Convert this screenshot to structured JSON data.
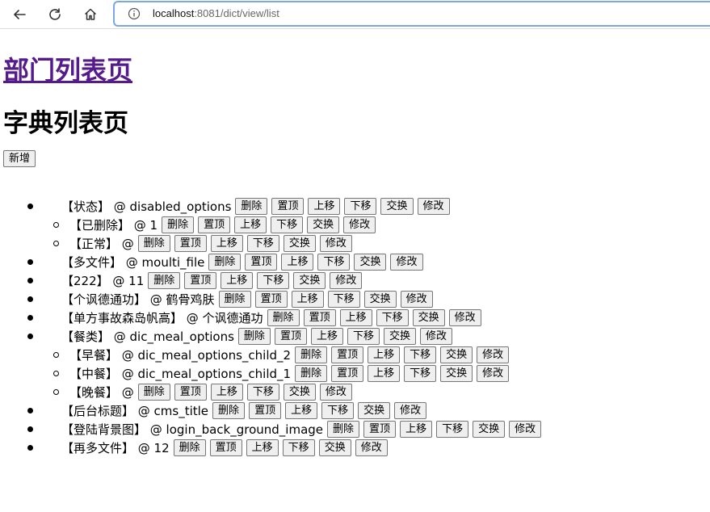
{
  "browser": {
    "url_host": "localhost",
    "url_path": ":8081/dict/view/list"
  },
  "page": {
    "dept_link": "部门列表页",
    "title": "字典列表页",
    "add_button": "新增"
  },
  "actions": [
    "删除",
    "置顶",
    "上移",
    "下移",
    "交换",
    "修改"
  ],
  "items": [
    {
      "label": "【状态】 @ disabled_options",
      "level": 0
    },
    {
      "label": "【已删除】 @ 1",
      "level": 1
    },
    {
      "label": "【正常】 @",
      "level": 1
    },
    {
      "label": "【多文件】 @ moulti_file",
      "level": 0
    },
    {
      "label": "【222】 @ 11",
      "level": 0
    },
    {
      "label": "【个讽德通功】 @ 鹤骨鸡肤",
      "level": 0
    },
    {
      "label": "【单方事故森岛帆高】 @ 个讽德通功",
      "level": 0
    },
    {
      "label": "【餐类】 @ dic_meal_options",
      "level": 0
    },
    {
      "label": "【早餐】 @ dic_meal_options_child_2",
      "level": 1
    },
    {
      "label": "【中餐】 @ dic_meal_options_child_1",
      "level": 1
    },
    {
      "label": "【晚餐】 @",
      "level": 1
    },
    {
      "label": "【后台标题】 @ cms_title",
      "level": 0
    },
    {
      "label": "【登陆背景图】 @ login_back_ground_image",
      "level": 0
    },
    {
      "label": "【再多文件】 @ 12",
      "level": 0
    }
  ]
}
